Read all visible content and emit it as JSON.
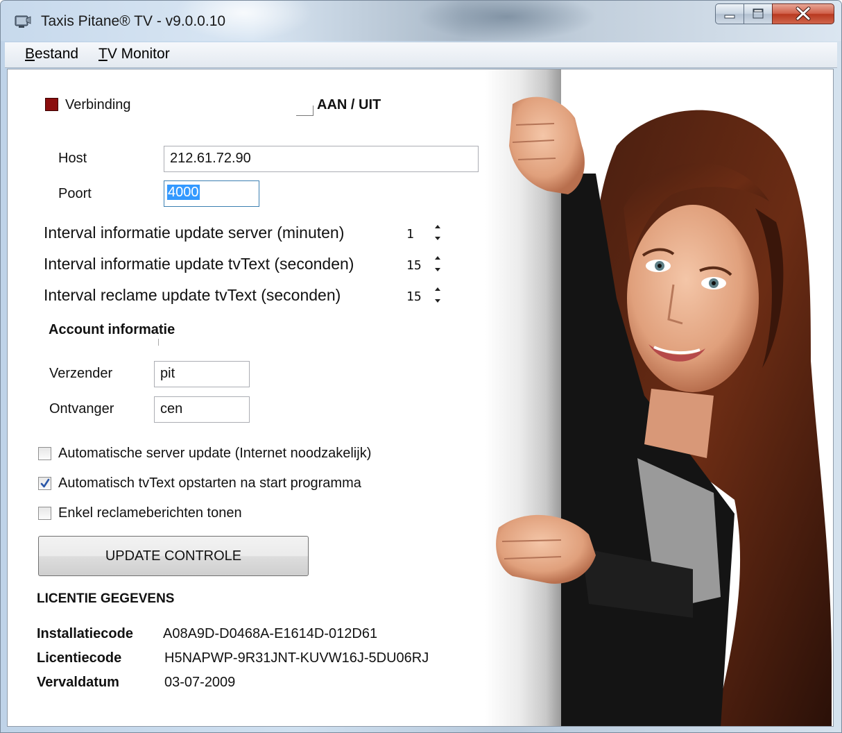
{
  "window": {
    "title": "Taxis Pitane® TV - v9.0.0.10",
    "controls": [
      "minimize",
      "maximize",
      "close"
    ]
  },
  "menu": {
    "items": [
      {
        "accel": "B",
        "rest": "estand"
      },
      {
        "accel": "T",
        "rest": "V Monitor"
      }
    ]
  },
  "connection": {
    "status_label": "Verbinding",
    "status_color": "#8b0d0d",
    "toggle_label": "AAN / UIT"
  },
  "server": {
    "host_label": "Host",
    "host_value": "212.61.72.90",
    "port_label": "Poort",
    "port_value": "4000"
  },
  "intervals": [
    {
      "label": "Interval informatie update server (minuten)",
      "value": "1"
    },
    {
      "label": "Interval informatie update tvText (seconden)",
      "value": "15"
    },
    {
      "label": "Interval reclame update tvText (seconden)",
      "value": "15"
    }
  ],
  "account": {
    "heading": "Account informatie",
    "sender_label": "Verzender",
    "sender_value": "pit",
    "receiver_label": "Ontvanger",
    "receiver_value": "cen"
  },
  "options": [
    {
      "label": "Automatische server update (Internet noodzakelijk)",
      "checked": false
    },
    {
      "label": "Automatisch tvText opstarten na start programma",
      "checked": true
    },
    {
      "label": "Enkel reclameberichten tonen",
      "checked": false
    }
  ],
  "update_button": "UPDATE CONTROLE",
  "license": {
    "heading": "LICENTIE GEGEVENS",
    "install_label": "Installatiecode",
    "install_value": "A08A9D-D0468A-E1614D-012D61",
    "license_label": "Licentiecode",
    "license_value": "H5NAPWP-9R31JNT-KUVW16J-5DU06RJ",
    "expiry_label": "Vervaldatum",
    "expiry_value": "03-07-2009"
  },
  "colors": {
    "checkmark": "#2a57a8",
    "selection": "#3399ff"
  }
}
